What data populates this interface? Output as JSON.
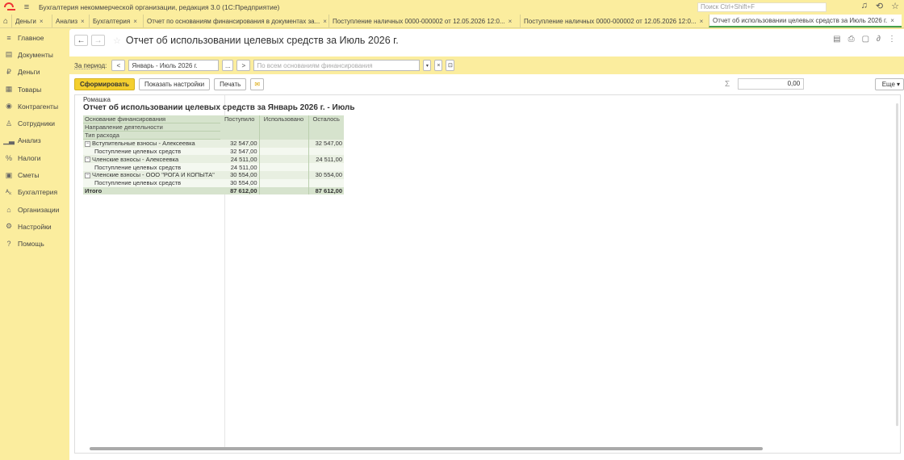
{
  "app": {
    "title": "Бухгалтерия некоммерческой организации, редакция 3.0  (1С:Предприятие)",
    "search_placeholder": "Поиск Ctrl+Shift+F"
  },
  "tabs": [
    {
      "label": "Деньги",
      "active": false
    },
    {
      "label": "Анализ",
      "active": false
    },
    {
      "label": "Бухгалтерия",
      "active": false
    },
    {
      "label": "Отчет по основаниям финансирования в документах за...",
      "active": false
    },
    {
      "label": "Поступление наличных 0000-000002 от 12.05.2026 12:0...",
      "active": false
    },
    {
      "label": "Поступление наличных 0000-000002 от 12.05.2026 12:0...",
      "active": false
    },
    {
      "label": "Отчет об использовании целевых средств за Июль 2026 г.",
      "active": true
    }
  ],
  "sidebar": {
    "items": [
      {
        "label": "Главное",
        "icon": "menu-icon"
      },
      {
        "label": "Документы",
        "icon": "document-icon"
      },
      {
        "label": "Деньги",
        "icon": "ruble-icon"
      },
      {
        "label": "Товары",
        "icon": "boxes-icon"
      },
      {
        "label": "Контрагенты",
        "icon": "contractor-icon"
      },
      {
        "label": "Сотрудники",
        "icon": "person-icon"
      },
      {
        "label": "Анализ",
        "icon": "chart-icon"
      },
      {
        "label": "Налоги",
        "icon": "percent-icon"
      },
      {
        "label": "Сметы",
        "icon": "calculator-icon"
      },
      {
        "label": "Бухгалтерия",
        "icon": "accounting-icon"
      },
      {
        "label": "Организации",
        "icon": "organization-icon"
      },
      {
        "label": "Настройки",
        "icon": "gear-icon"
      },
      {
        "label": "Помощь",
        "icon": "help-icon"
      }
    ]
  },
  "header": {
    "title": "Отчет об использовании целевых средств за Июль 2026 г."
  },
  "filters": {
    "period_label": "За период:",
    "period_value": "Январь - Июль 2026 г.",
    "prev": "<",
    "next": ">",
    "dots": "...",
    "basis_placeholder": "По всем основаниям финансирования"
  },
  "toolbar": {
    "generate": "Сформировать",
    "settings": "Показать настройки",
    "print": "Печать",
    "sum_value": "0,00",
    "more": "Еще"
  },
  "report": {
    "org": "Ромашка",
    "title": "Отчет об использовании целевых средств за Январь 2026 г. - Июль",
    "headers": {
      "basis": "Основание финансирования",
      "direction": "Направление деятельности",
      "expense": "Тип расхода",
      "received": "Поступило",
      "used": "Использовано",
      "remaining": "Осталось"
    },
    "rows": [
      {
        "kind": "group",
        "name": "Вступительные взносы - Алексеевка",
        "received": "32 547,00",
        "used": "",
        "remaining": "32 547,00"
      },
      {
        "kind": "detail",
        "name": "Поступление целевых средств",
        "received": "32 547,00",
        "used": "",
        "remaining": ""
      },
      {
        "kind": "group",
        "name": "Членские взносы - Алексеевка",
        "received": "24 511,00",
        "used": "",
        "remaining": "24 511,00"
      },
      {
        "kind": "detail",
        "name": "Поступление целевых средств",
        "received": "24 511,00",
        "used": "",
        "remaining": ""
      },
      {
        "kind": "group",
        "name": "Членские взносы - ООО \"РОГА И КОПЫТА\"",
        "received": "30 554,00",
        "used": "",
        "remaining": "30 554,00"
      },
      {
        "kind": "detail",
        "name": "Поступление целевых средств",
        "received": "30 554,00",
        "used": "",
        "remaining": ""
      }
    ],
    "total": {
      "name": "Итого",
      "received": "87 612,00",
      "used": "",
      "remaining": "87 612,00"
    }
  }
}
